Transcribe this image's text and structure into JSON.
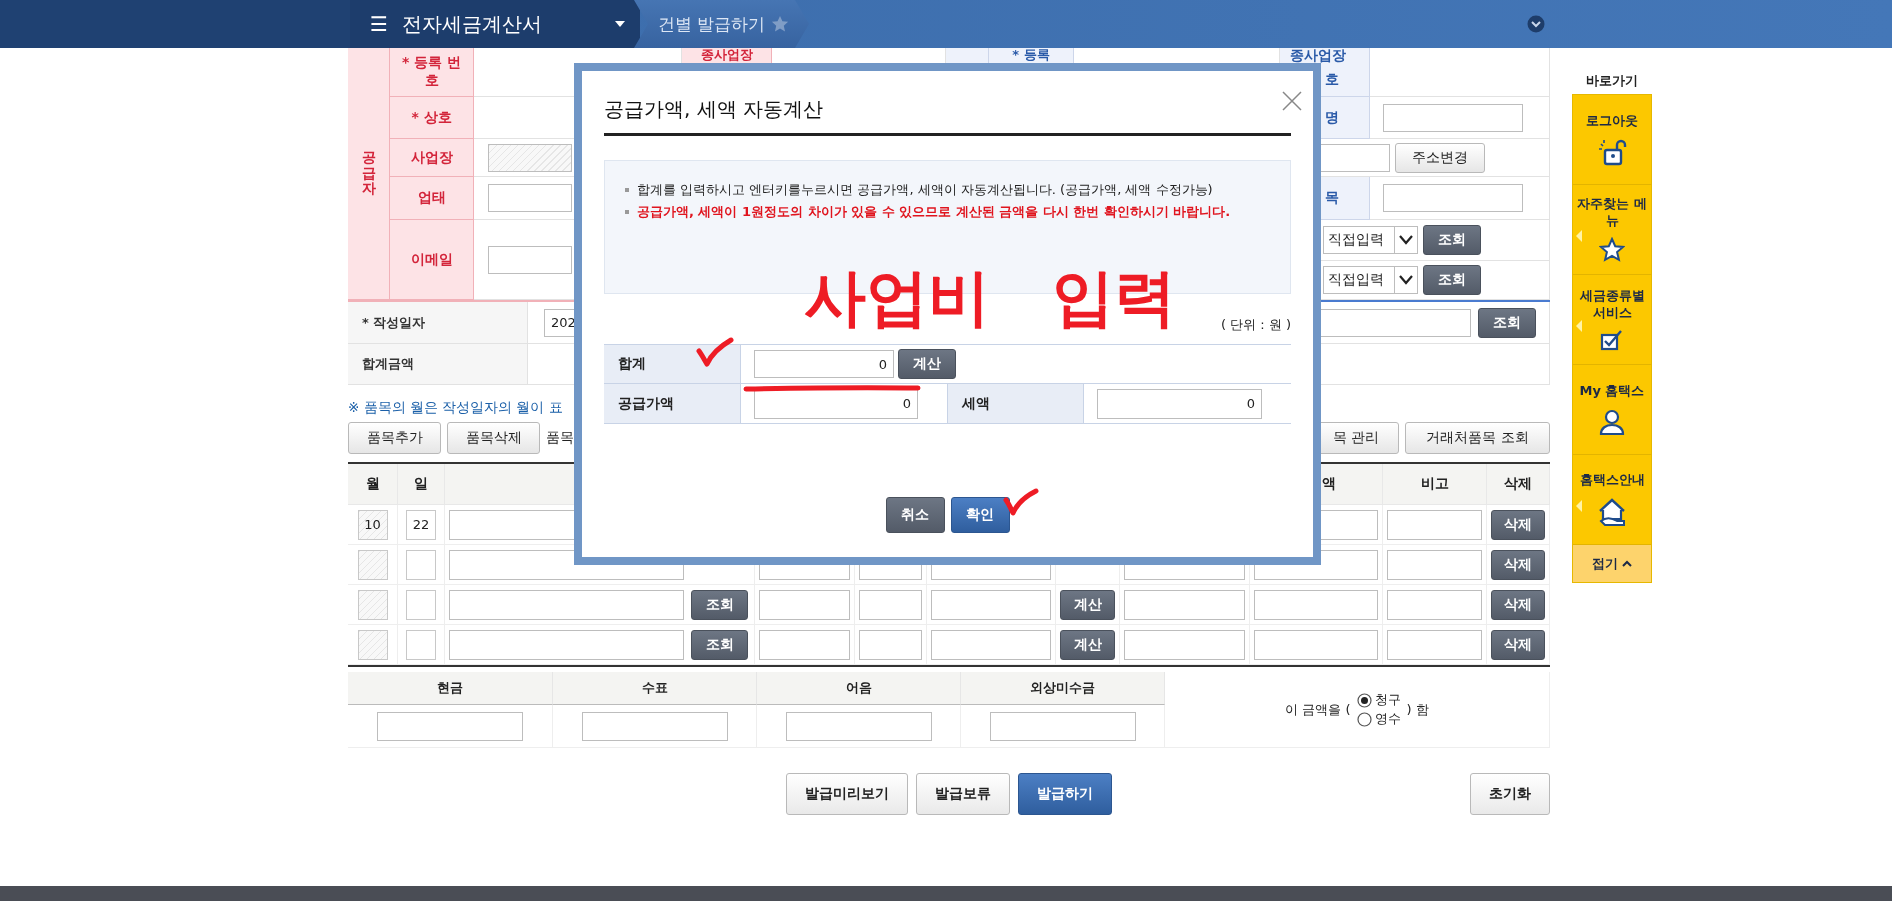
{
  "topbar": {
    "menu_icon": "☰",
    "title": "전자세금계산서",
    "breadcrumb": "건별 발급하기"
  },
  "supplier": {
    "side_label": "공급자",
    "branch_label": "종사업장",
    "rows": [
      {
        "label": "* 등록 번호",
        "kind": "blank"
      },
      {
        "label": "* 상호",
        "kind": "blank"
      },
      {
        "label": "사업장",
        "kind": "readonly"
      },
      {
        "label": "업태",
        "kind": "field"
      },
      {
        "label": "이메일",
        "kind": "field"
      }
    ]
  },
  "receiver": {
    "reg_label": "* 등록",
    "branch_label": "종사업장",
    "branch_label_tail": "호",
    "name_label": "명",
    "address_button": "주소변경",
    "item_label": "목",
    "email_rows": [
      {
        "select": "직접입력",
        "button": "조회"
      },
      {
        "select": "직접입력",
        "button": "조회"
      }
    ]
  },
  "issue_date": {
    "label": "* 작성일자",
    "value": "202",
    "button": "조회"
  },
  "total_amount": {
    "label": "합계금액"
  },
  "note": "※ 품목의 월은 작성일자의 월이 표",
  "item_toolbar": {
    "left_buttons": [
      "품목추가",
      "품목삭제"
    ],
    "text": "품목",
    "right_buttons": [
      "목 관리",
      "거래처품목 조회"
    ]
  },
  "items": {
    "headers": {
      "month": "월",
      "day": "일",
      "tax": "액",
      "remark": "비고",
      "delete": "삭제"
    },
    "rows": [
      {
        "month": "10",
        "day": "22",
        "delete": "삭제"
      },
      {
        "delete": "삭제"
      },
      {
        "lookup": "조회",
        "calc": "계산",
        "delete": "삭제"
      },
      {
        "lookup": "조회",
        "calc": "계산",
        "delete": "삭제"
      }
    ]
  },
  "payment": {
    "columns": [
      "현금",
      "수표",
      "어음",
      "외상미수금"
    ],
    "prefix": "이 금액을 (",
    "options": [
      {
        "label": "청구",
        "selected": true
      },
      {
        "label": "영수",
        "selected": false
      }
    ],
    "suffix": ") 함"
  },
  "actions": [
    {
      "label": "발급미리보기",
      "kind": "default"
    },
    {
      "label": "발급보류",
      "kind": "default"
    },
    {
      "label": "발급하기",
      "kind": "primary"
    }
  ],
  "reset_button": "초기화",
  "quick_menu": {
    "title": "바로가기",
    "collapse": "접기",
    "items": [
      {
        "label": "로그아웃",
        "flyout": false
      },
      {
        "label": "자주찾는 메뉴",
        "flyout": true
      },
      {
        "label": "세금종류별 서비스",
        "flyout": true
      },
      {
        "label": "My 홈택스",
        "flyout": false
      },
      {
        "label": "홈택스안내",
        "flyout": true
      }
    ]
  },
  "dialog": {
    "title": "공급가액, 세액 자동계산",
    "notes": [
      {
        "text": "합계를 입력하시고 엔터키를누르시면 공급가액, 세액이 자동계산됩니다. (공급가액, 세액 수정가능)",
        "kind": "plain"
      },
      {
        "text": "공급가액, 세액이 1원정도의 차이가 있을 수 있으므로 계산된 금액을 다시 한번 확인하시기 바랍니다.",
        "kind": "warning"
      }
    ],
    "unit": "( 단위 : 원 )",
    "total": {
      "label": "합계",
      "value": "0",
      "button": "계산"
    },
    "supply": {
      "label": "공급가액",
      "value": "0"
    },
    "tax": {
      "label": "세액",
      "value": "0"
    },
    "buttons": [
      {
        "label": "취소",
        "kind": "dark"
      },
      {
        "label": "확인",
        "kind": "primary"
      }
    ]
  },
  "annotation": {
    "text": "사업비 입력"
  }
}
